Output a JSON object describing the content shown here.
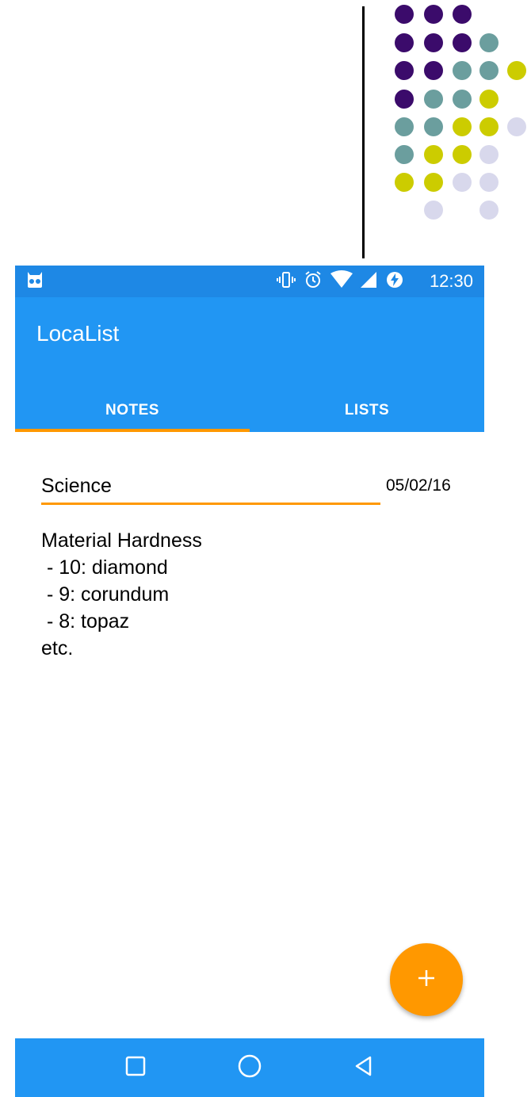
{
  "status_bar": {
    "time": "12:30",
    "icons": [
      "android-debug-icon",
      "vibrate-icon",
      "alarm-icon",
      "wifi-icon",
      "signal-icon",
      "battery-charging-icon"
    ]
  },
  "app": {
    "title": "LocaList"
  },
  "tabs": [
    {
      "label": "NOTES",
      "selected": true
    },
    {
      "label": "LISTS",
      "selected": false
    }
  ],
  "note": {
    "title": "Science",
    "date": "05/02/16",
    "body": "Material Hardness\n - 10: diamond\n - 9: corundum\n - 8: topaz\netc."
  },
  "fab": {
    "icon": "plus-icon"
  },
  "nav": {
    "icons": [
      "recents-square-icon",
      "home-circle-icon",
      "back-triangle-icon"
    ]
  },
  "colors": {
    "primary": "#2196F3",
    "primary_dark": "#1E88E5",
    "accent": "#FF9800",
    "dot_purple": "#3B0B6B",
    "dot_teal": "#6B9E9E",
    "dot_yellow": "#CCCC00",
    "dot_lavender": "#D8D8EC"
  }
}
